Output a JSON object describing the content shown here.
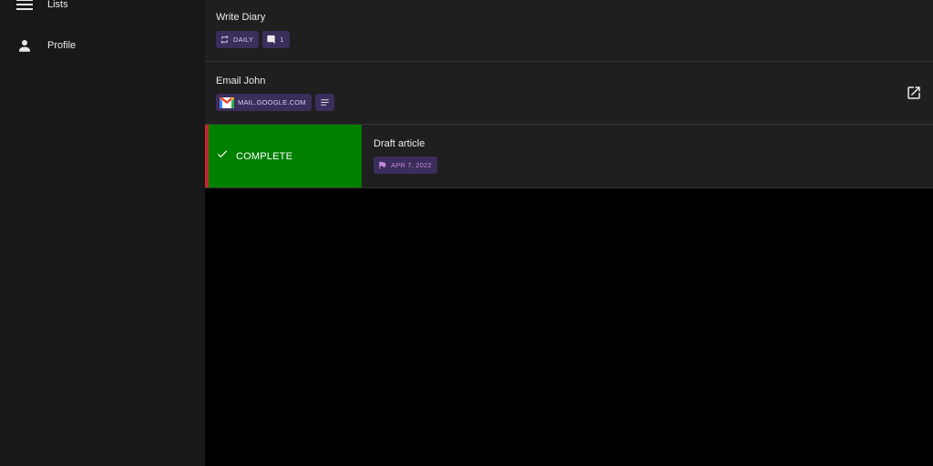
{
  "sidebar": {
    "items": [
      {
        "label": "Lists",
        "icon": "menu-icon"
      },
      {
        "label": "Profile",
        "icon": "person-icon"
      }
    ]
  },
  "tasks": [
    {
      "title": "Write Diary",
      "chips": [
        {
          "icon": "repeat-icon",
          "text": "DAILY"
        },
        {
          "icon": "comment-icon",
          "text": "1"
        }
      ]
    },
    {
      "title": "Email John",
      "chips": [
        {
          "icon": "gmail-icon",
          "text": "MAIL.GOOGLE.COM"
        },
        {
          "icon": "notes-icon",
          "text": ""
        }
      ],
      "action_icon": "open-in-new-icon"
    },
    {
      "title": "Draft article",
      "swipe_action": {
        "label": "COMPLETE",
        "icon": "check-icon"
      },
      "chips": [
        {
          "icon": "flag-icon",
          "text": "APR 7, 2022"
        }
      ]
    }
  ],
  "colors": {
    "sidebar_bg": "#181818",
    "task_bg": "#1f1f1f",
    "chip_bg": "#3b2d5c",
    "complete_green": "#008000",
    "swipe_border_red": "#c0282d",
    "date_chip_text": "#c58ad9"
  }
}
